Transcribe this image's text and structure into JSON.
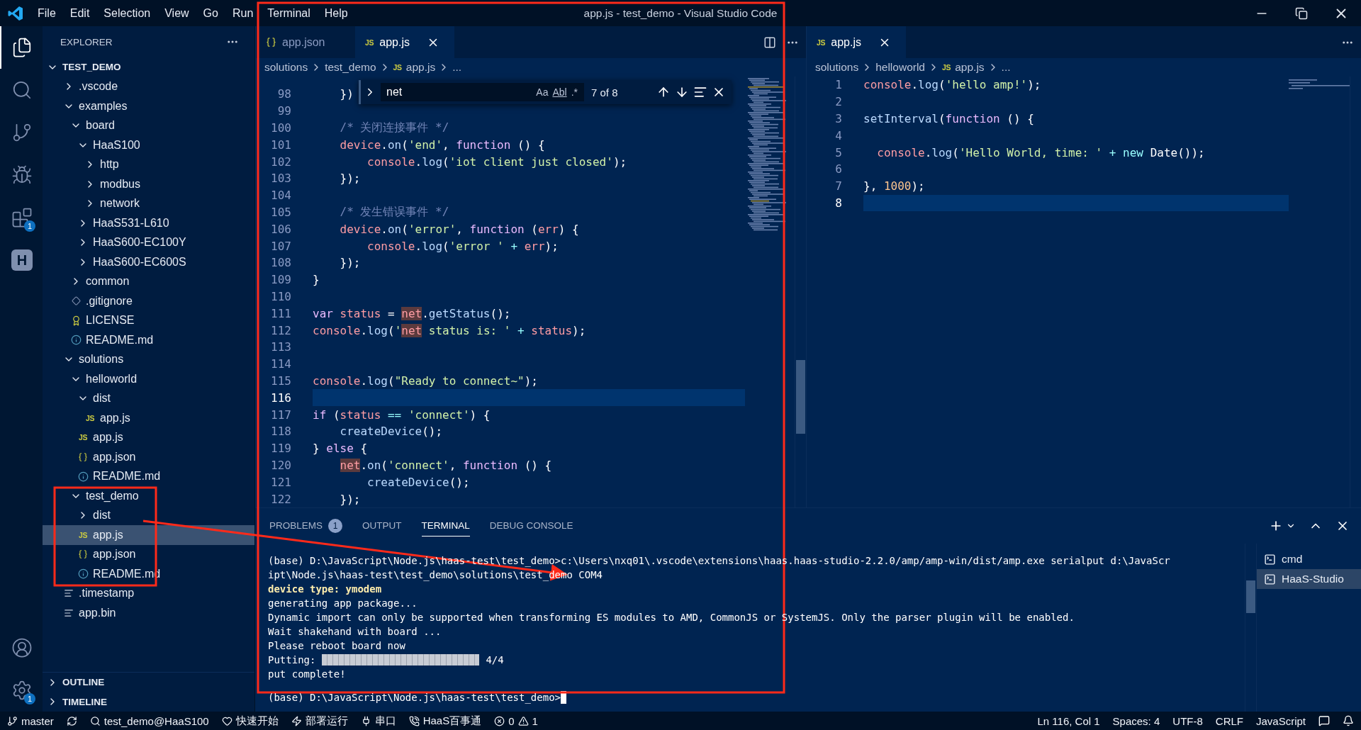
{
  "window": {
    "title": "app.js - test_demo - Visual Studio Code"
  },
  "menu": [
    "File",
    "Edit",
    "Selection",
    "View",
    "Go",
    "Run",
    "Terminal",
    "Help"
  ],
  "activity_bar": {
    "items": [
      {
        "kind": "files",
        "selected": true
      },
      {
        "kind": "search",
        "selected": false
      },
      {
        "kind": "scm",
        "selected": false
      },
      {
        "kind": "debug",
        "selected": false
      },
      {
        "kind": "extensions",
        "selected": false,
        "badge": "1"
      },
      {
        "kind": "haas",
        "selected": false,
        "glyph": "H"
      }
    ],
    "bottom": [
      {
        "kind": "account"
      },
      {
        "kind": "settings",
        "badge": "1"
      }
    ]
  },
  "sidebar": {
    "title": "EXPLORER",
    "root": {
      "label": "TEST_DEMO",
      "expanded": true
    },
    "tree": [
      {
        "label": ".vscode",
        "kind": "folder",
        "expanded": false,
        "selected": false
      },
      {
        "label": "examples",
        "kind": "folder",
        "expanded": true,
        "selected": false,
        "children": [
          {
            "label": "board",
            "kind": "folder",
            "expanded": true,
            "selected": false,
            "children": [
              {
                "label": "HaaS100",
                "kind": "folder",
                "expanded": true,
                "selected": false,
                "children": [
                  {
                    "label": "http",
                    "kind": "folder",
                    "expanded": false,
                    "selected": false
                  },
                  {
                    "label": "modbus",
                    "kind": "folder",
                    "expanded": false,
                    "selected": false
                  },
                  {
                    "label": "network",
                    "kind": "folder",
                    "expanded": false,
                    "selected": false
                  }
                ]
              },
              {
                "label": "HaaS531-L610",
                "kind": "folder",
                "expanded": false,
                "selected": false
              },
              {
                "label": "HaaS600-EC100Y",
                "kind": "folder",
                "expanded": false,
                "selected": false
              },
              {
                "label": "HaaS600-EC600S",
                "kind": "folder",
                "expanded": false,
                "selected": false
              }
            ]
          },
          {
            "label": "common",
            "kind": "folder",
            "expanded": false,
            "selected": false
          },
          {
            "label": ".gitignore",
            "kind": "git",
            "selected": false
          },
          {
            "label": "LICENSE",
            "kind": "license",
            "selected": false
          },
          {
            "label": "README.md",
            "kind": "info",
            "selected": false
          }
        ]
      },
      {
        "label": "solutions",
        "kind": "folder",
        "expanded": true,
        "selected": false,
        "children": [
          {
            "label": "helloworld",
            "kind": "folder",
            "expanded": true,
            "selected": false,
            "children": [
              {
                "label": "dist",
                "kind": "folder",
                "expanded": true,
                "selected": false,
                "children": [
                  {
                    "label": "app.js",
                    "kind": "js",
                    "glyph": "JS",
                    "selected": false
                  }
                ]
              },
              {
                "label": "app.js",
                "kind": "js",
                "glyph": "JS",
                "selected": false
              },
              {
                "label": "app.json",
                "kind": "json",
                "selected": false
              },
              {
                "label": "README.md",
                "kind": "info",
                "selected": false
              }
            ]
          },
          {
            "label": "test_demo",
            "kind": "folder",
            "expanded": true,
            "selected": false,
            "children": [
              {
                "label": "dist",
                "kind": "folder",
                "expanded": false,
                "selected": false
              },
              {
                "label": "app.js",
                "kind": "js",
                "glyph": "JS",
                "selected": true
              },
              {
                "label": "app.json",
                "kind": "json",
                "selected": false
              },
              {
                "label": "README.md",
                "kind": "info",
                "selected": false
              }
            ]
          }
        ]
      },
      {
        "label": ".timestamp",
        "kind": "lines",
        "selected": false
      },
      {
        "label": "app.bin",
        "kind": "lines",
        "selected": false
      }
    ],
    "sections": [
      {
        "label": "OUTLINE",
        "expanded": false
      },
      {
        "label": "TIMELINE",
        "expanded": false
      }
    ]
  },
  "editors": [
    {
      "tabs": [
        {
          "label": "app.json",
          "kind": "json",
          "selected": false
        },
        {
          "label": "app.js",
          "kind": "js",
          "glyph": "JS",
          "selected": true
        }
      ],
      "breadcrumb": [
        {
          "label": "solutions"
        },
        {
          "label": "test_demo"
        },
        {
          "label": "app.js",
          "kind": "js",
          "glyph": "JS"
        },
        {
          "label": "..."
        }
      ],
      "find": {
        "query": "net",
        "options": [
          "Aa",
          "Abl",
          ".*"
        ],
        "result": "7 of 8"
      },
      "lines": [
        {
          "n": "98",
          "current": false,
          "tokens": [
            {
              "text": "    })",
              "kind": "plain"
            }
          ]
        },
        {
          "n": "99",
          "current": false
        },
        {
          "n": "100",
          "current": false,
          "tokens": [
            {
              "text": "    /* 关闭连接事件 */",
              "kind": "comment"
            }
          ]
        },
        {
          "n": "101",
          "current": false,
          "tokens": [
            {
              "text": "    device",
              "kind": "var"
            },
            {
              "text": ".",
              "kind": "plain"
            },
            {
              "text": "on",
              "kind": "fn"
            },
            {
              "text": "(",
              "kind": "plain"
            },
            {
              "text": "'end'",
              "kind": "str"
            },
            {
              "text": ", ",
              "kind": "plain"
            },
            {
              "text": "function",
              "kind": "kw"
            },
            {
              "text": " () {",
              "kind": "plain"
            }
          ]
        },
        {
          "n": "102",
          "current": false,
          "tokens": [
            {
              "text": "        console",
              "kind": "var"
            },
            {
              "text": ".",
              "kind": "plain"
            },
            {
              "text": "log",
              "kind": "fn"
            },
            {
              "text": "(",
              "kind": "plain"
            },
            {
              "text": "'iot client just closed'",
              "kind": "str"
            },
            {
              "text": ");",
              "kind": "plain"
            }
          ]
        },
        {
          "n": "103",
          "current": false,
          "tokens": [
            {
              "text": "    });",
              "kind": "plain"
            }
          ]
        },
        {
          "n": "104",
          "current": false
        },
        {
          "n": "105",
          "current": false,
          "tokens": [
            {
              "text": "    /* 发生错误事件 */",
              "kind": "comment"
            }
          ]
        },
        {
          "n": "106",
          "current": false,
          "tokens": [
            {
              "text": "    device",
              "kind": "var"
            },
            {
              "text": ".",
              "kind": "plain"
            },
            {
              "text": "on",
              "kind": "fn"
            },
            {
              "text": "(",
              "kind": "plain"
            },
            {
              "text": "'error'",
              "kind": "str"
            },
            {
              "text": ", ",
              "kind": "plain"
            },
            {
              "text": "function",
              "kind": "kw"
            },
            {
              "text": " (",
              "kind": "plain"
            },
            {
              "text": "err",
              "kind": "var"
            },
            {
              "text": ") {",
              "kind": "plain"
            }
          ]
        },
        {
          "n": "107",
          "current": false,
          "tokens": [
            {
              "text": "        console",
              "kind": "var"
            },
            {
              "text": ".",
              "kind": "plain"
            },
            {
              "text": "log",
              "kind": "fn"
            },
            {
              "text": "(",
              "kind": "plain"
            },
            {
              "text": "'error '",
              "kind": "str"
            },
            {
              "text": " + ",
              "kind": "op"
            },
            {
              "text": "err",
              "kind": "var"
            },
            {
              "text": ");",
              "kind": "plain"
            }
          ]
        },
        {
          "n": "108",
          "current": false,
          "tokens": [
            {
              "text": "    });",
              "kind": "plain"
            }
          ]
        },
        {
          "n": "109",
          "current": false,
          "tokens": [
            {
              "text": "}",
              "kind": "plain"
            }
          ]
        },
        {
          "n": "110",
          "current": false
        },
        {
          "n": "111",
          "current": false,
          "tokens": [
            {
              "text": "var",
              "kind": "kw"
            },
            {
              "text": " status",
              "kind": "var"
            },
            {
              "text": " = ",
              "kind": "plain"
            },
            {
              "text": "net",
              "kind": "match"
            },
            {
              "text": ".",
              "kind": "plain"
            },
            {
              "text": "getStatus",
              "kind": "fn"
            },
            {
              "text": "();",
              "kind": "plain"
            }
          ]
        },
        {
          "n": "112",
          "current": false,
          "tokens": [
            {
              "text": "console",
              "kind": "var"
            },
            {
              "text": ".",
              "kind": "plain"
            },
            {
              "text": "log",
              "kind": "fn"
            },
            {
              "text": "(",
              "kind": "plain"
            },
            {
              "text": "'",
              "kind": "str"
            },
            {
              "text": "net",
              "kind": "match"
            },
            {
              "text": " status is: '",
              "kind": "str"
            },
            {
              "text": " + ",
              "kind": "op"
            },
            {
              "text": "status",
              "kind": "var"
            },
            {
              "text": ");",
              "kind": "plain"
            }
          ]
        },
        {
          "n": "113",
          "current": false
        },
        {
          "n": "114",
          "current": false
        },
        {
          "n": "115",
          "current": false,
          "tokens": [
            {
              "text": "console",
              "kind": "var"
            },
            {
              "text": ".",
              "kind": "plain"
            },
            {
              "text": "log",
              "kind": "fn"
            },
            {
              "text": "(",
              "kind": "plain"
            },
            {
              "text": "\"Ready to connect~\"",
              "kind": "str"
            },
            {
              "text": ");",
              "kind": "plain"
            }
          ]
        },
        {
          "n": "116",
          "current": true
        },
        {
          "n": "117",
          "current": false,
          "tokens": [
            {
              "text": "if",
              "kind": "kw"
            },
            {
              "text": " (",
              "kind": "plain"
            },
            {
              "text": "status",
              "kind": "var"
            },
            {
              "text": " == ",
              "kind": "op"
            },
            {
              "text": "'connect'",
              "kind": "str"
            },
            {
              "text": ") {",
              "kind": "plain"
            }
          ]
        },
        {
          "n": "118",
          "current": false,
          "tokens": [
            {
              "text": "    createDevice",
              "kind": "fn"
            },
            {
              "text": "();",
              "kind": "plain"
            }
          ]
        },
        {
          "n": "119",
          "current": false,
          "tokens": [
            {
              "text": "} ",
              "kind": "plain"
            },
            {
              "text": "else",
              "kind": "kw"
            },
            {
              "text": " {",
              "kind": "plain"
            }
          ]
        },
        {
          "n": "120",
          "current": false,
          "tokens": [
            {
              "text": "    net",
              "kind": "match"
            },
            {
              "text": ".",
              "kind": "plain"
            },
            {
              "text": "on",
              "kind": "fn"
            },
            {
              "text": "(",
              "kind": "plain"
            },
            {
              "text": "'connect'",
              "kind": "str"
            },
            {
              "text": ", ",
              "kind": "plain"
            },
            {
              "text": "function",
              "kind": "kw"
            },
            {
              "text": " () {",
              "kind": "plain"
            }
          ]
        },
        {
          "n": "121",
          "current": false,
          "tokens": [
            {
              "text": "        createDevice",
              "kind": "fn"
            },
            {
              "text": "();",
              "kind": "plain"
            }
          ]
        },
        {
          "n": "122",
          "current": false,
          "tokens": [
            {
              "text": "    });",
              "kind": "plain"
            }
          ]
        }
      ]
    },
    {
      "tabs": [
        {
          "label": "app.js",
          "kind": "js",
          "glyph": "JS",
          "selected": true
        }
      ],
      "breadcrumb": [
        {
          "label": "solutions"
        },
        {
          "label": "helloworld"
        },
        {
          "label": "app.js",
          "kind": "js",
          "glyph": "JS"
        },
        {
          "label": "..."
        }
      ],
      "lines": [
        {
          "n": "1",
          "current": false,
          "tokens": [
            {
              "text": "console",
              "kind": "var"
            },
            {
              "text": ".",
              "kind": "plain"
            },
            {
              "text": "log",
              "kind": "fn"
            },
            {
              "text": "(",
              "kind": "plain"
            },
            {
              "text": "'hello amp!'",
              "kind": "str"
            },
            {
              "text": ");",
              "kind": "plain"
            }
          ]
        },
        {
          "n": "2",
          "current": false
        },
        {
          "n": "3",
          "current": false,
          "tokens": [
            {
              "text": "setInterval",
              "kind": "fn"
            },
            {
              "text": "(",
              "kind": "plain"
            },
            {
              "text": "function",
              "kind": "kw"
            },
            {
              "text": " () {",
              "kind": "plain"
            }
          ]
        },
        {
          "n": "4",
          "current": false
        },
        {
          "n": "5",
          "current": false,
          "tokens": [
            {
              "text": "  console",
              "kind": "var"
            },
            {
              "text": ".",
              "kind": "plain"
            },
            {
              "text": "log",
              "kind": "fn"
            },
            {
              "text": "(",
              "kind": "plain"
            },
            {
              "text": "'Hello World, time: '",
              "kind": "str"
            },
            {
              "text": " + ",
              "kind": "op"
            },
            {
              "text": "new",
              "kind": "op"
            },
            {
              "text": " Date());",
              "kind": "plain"
            }
          ]
        },
        {
          "n": "6",
          "current": false
        },
        {
          "n": "7",
          "current": false,
          "tokens": [
            {
              "text": "}, ",
              "kind": "plain"
            },
            {
              "text": "1000",
              "kind": "num"
            },
            {
              "text": ");",
              "kind": "plain"
            }
          ]
        },
        {
          "n": "8",
          "current": true
        }
      ]
    }
  ],
  "panel": {
    "tabs": [
      {
        "label": "PROBLEMS",
        "badge": "1",
        "selected": false
      },
      {
        "label": "OUTPUT",
        "selected": false
      },
      {
        "label": "TERMINAL",
        "selected": true
      },
      {
        "label": "DEBUG CONSOLE",
        "selected": false
      }
    ],
    "terminal": {
      "lines": [
        {
          "kind": "text",
          "text": "(base) D:\\JavaScript\\Node.js\\haas-test\\test_demo>c:\\Users\\nxq01\\.vscode\\extensions\\haas.haas-studio-2.2.0/amp/amp-win/dist/amp.exe serialput d:\\JavaScr"
        },
        {
          "kind": "text",
          "text": "ipt\\Node.js\\haas-test\\test_demo\\solutions\\test_demo COM4"
        },
        {
          "kind": "highlight",
          "text": "device type: ymodem"
        },
        {
          "kind": "text",
          "text": "generating app package..."
        },
        {
          "kind": "text",
          "text": "Dynamic import can only be supported when transforming ES modules to AMD, CommonJS or SystemJS. Only the parser plugin will be enabled."
        },
        {
          "kind": "text",
          "text": "Wait shakehand with board ..."
        },
        {
          "kind": "text",
          "text": "Please reboot board now"
        },
        {
          "kind": "progress",
          "label": "Putting:",
          "level": 1,
          "reading": "4/4"
        },
        {
          "kind": "text",
          "text": "put complete!"
        },
        {
          "kind": "prompt",
          "text": "(base) D:\\JavaScript\\Node.js\\haas-test\\test_demo>"
        }
      ]
    },
    "terminals": [
      {
        "label": "cmd",
        "selected": false
      },
      {
        "label": "HaaS-Studio",
        "selected": true
      }
    ]
  },
  "status_bar": {
    "left": [
      {
        "kind": "branch",
        "text": "master"
      },
      {
        "kind": "sync"
      },
      {
        "kind": "device",
        "text": "test_demo@HaaS100"
      },
      {
        "kind": "heart",
        "text": "快速开始"
      },
      {
        "kind": "deploy",
        "text": "部署运行"
      },
      {
        "kind": "serial",
        "text": "串口"
      },
      {
        "kind": "help",
        "text": "HaaS百事通"
      },
      {
        "kind": "problems",
        "errors": "0",
        "warnings": "1"
      }
    ],
    "right": [
      "Ln 116, Col 1",
      "Spaces: 4",
      "UTF-8",
      "CRLF",
      "JavaScript"
    ]
  }
}
